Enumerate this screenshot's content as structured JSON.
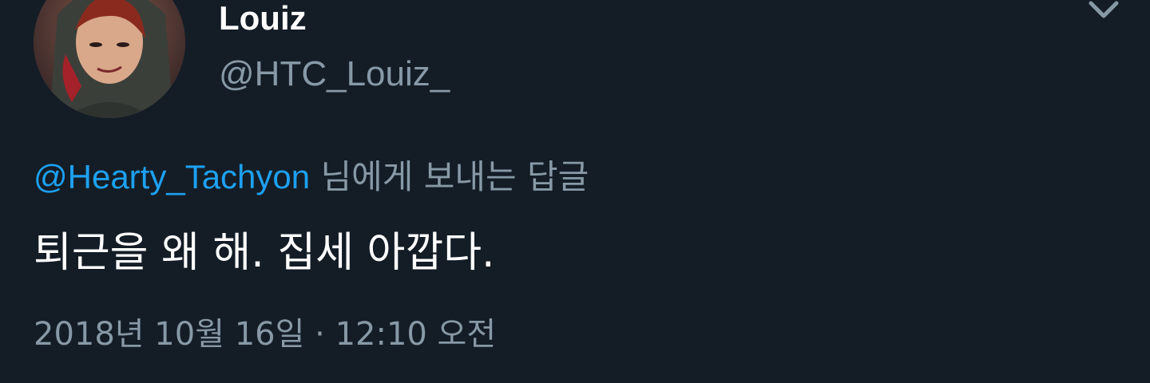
{
  "user": {
    "display_name": "Louiz",
    "handle": "@HTC_Louiz_"
  },
  "reply": {
    "mention": "@Hearty_Tachyon",
    "suffix": " 님에게 보내는 답글"
  },
  "tweet": {
    "text": "퇴근을 왜 해. 집세 아깝다.",
    "timestamp": "2018년 10월 16일 · 12:10 오전"
  },
  "icons": {
    "menu": "chevron-down-icon"
  },
  "colors": {
    "background": "#141d26",
    "mention": "#1da1f2",
    "secondary_text": "#8899a6",
    "primary_text": "#ffffff"
  }
}
